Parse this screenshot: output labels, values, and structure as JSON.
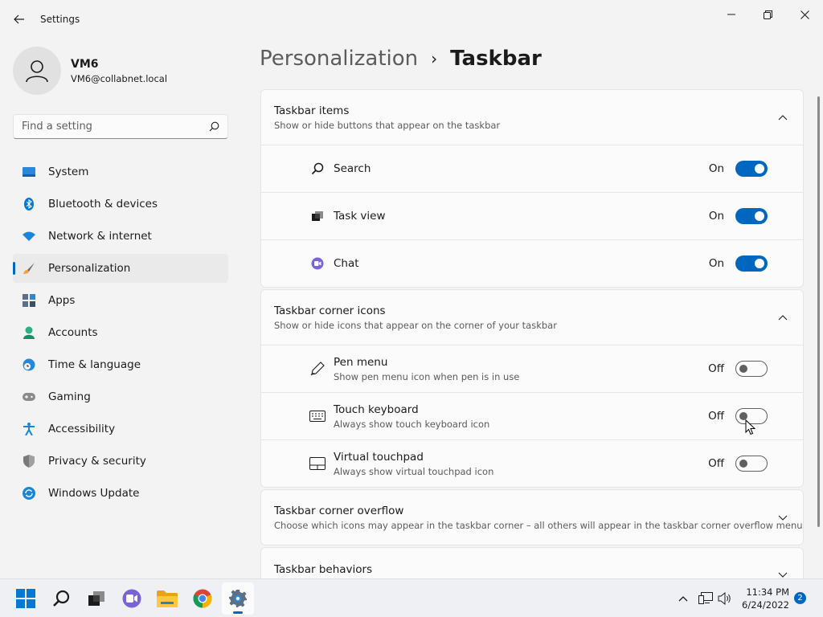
{
  "window": {
    "title": "Settings"
  },
  "user": {
    "name": "VM6",
    "email": "VM6@collabnet.local"
  },
  "search": {
    "placeholder": "Find a setting"
  },
  "nav": [
    {
      "label": "System",
      "icon": "monitor-icon"
    },
    {
      "label": "Bluetooth & devices",
      "icon": "bluetooth-icon"
    },
    {
      "label": "Network & internet",
      "icon": "wifi-icon"
    },
    {
      "label": "Personalization",
      "icon": "brush-icon",
      "active": true
    },
    {
      "label": "Apps",
      "icon": "apps-icon"
    },
    {
      "label": "Accounts",
      "icon": "person-icon"
    },
    {
      "label": "Time & language",
      "icon": "globe-clock-icon"
    },
    {
      "label": "Gaming",
      "icon": "gamepad-icon"
    },
    {
      "label": "Accessibility",
      "icon": "accessibility-icon"
    },
    {
      "label": "Privacy & security",
      "icon": "shield-icon"
    },
    {
      "label": "Windows Update",
      "icon": "update-icon"
    }
  ],
  "breadcrumb": {
    "parent": "Personalization",
    "separator": "›",
    "current": "Taskbar"
  },
  "groups": {
    "items": {
      "title": "Taskbar items",
      "subtitle": "Show or hide buttons that appear on the taskbar",
      "rows": [
        {
          "title": "Search",
          "state": "On"
        },
        {
          "title": "Task view",
          "state": "On"
        },
        {
          "title": "Chat",
          "state": "On"
        }
      ]
    },
    "corner_icons": {
      "title": "Taskbar corner icons",
      "subtitle": "Show or hide icons that appear on the corner of your taskbar",
      "rows": [
        {
          "title": "Pen menu",
          "subtitle": "Show pen menu icon when pen is in use",
          "state": "Off"
        },
        {
          "title": "Touch keyboard",
          "subtitle": "Always show touch keyboard icon",
          "state": "Off"
        },
        {
          "title": "Virtual touchpad",
          "subtitle": "Always show virtual touchpad icon",
          "state": "Off"
        }
      ]
    },
    "overflow": {
      "title": "Taskbar corner overflow",
      "subtitle": "Choose which icons may appear in the taskbar corner – all others will appear in the taskbar corner overflow menu"
    },
    "behaviors": {
      "title": "Taskbar behaviors"
    }
  },
  "taskbar": {
    "time": "11:34 PM",
    "date": "6/24/2022",
    "notification_count": "2"
  },
  "colors": {
    "accent": "#0067c0",
    "background": "#f3f3f3",
    "card": "#fbfbfb"
  }
}
